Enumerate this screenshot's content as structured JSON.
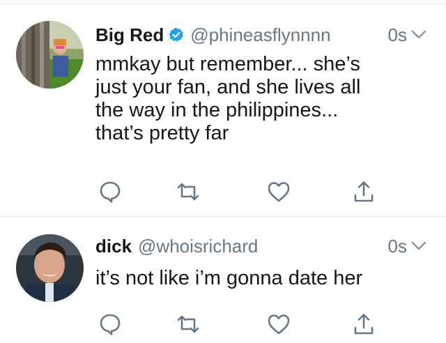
{
  "tweets": [
    {
      "display_name": "Big Red",
      "verified": true,
      "handle": "@phineasflynnnn",
      "time": "0s",
      "text": "mmkay but remember... she’s\njust your fan, and she lives all\nthe way in the philippines...\nthat’s pretty far",
      "actions": [
        "reply-icon",
        "retweet-icon",
        "like-icon",
        "share-icon"
      ]
    },
    {
      "display_name": "dick",
      "verified": false,
      "handle": "@whoisrichard",
      "time": "0s",
      "text": "it’s not like i’m gonna date her",
      "actions": [
        "reply-icon",
        "retweet-icon",
        "like-icon",
        "share-icon"
      ]
    }
  ],
  "colors": {
    "text": "#14171a",
    "secondary": "#657786",
    "verified_blue": "#1da1f2",
    "divider": "#e1e8ed"
  }
}
